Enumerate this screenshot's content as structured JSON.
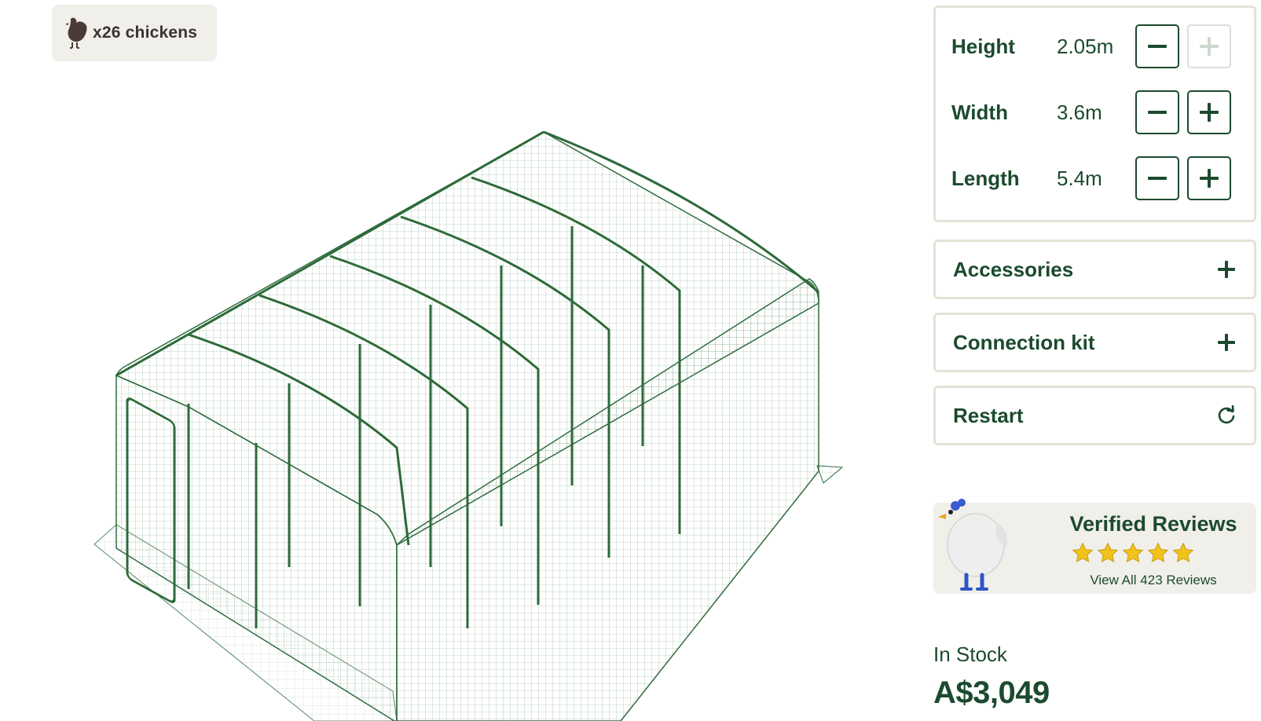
{
  "badge": {
    "icon": "chicken-icon",
    "label": "x26 chickens"
  },
  "dimensions": [
    {
      "label": "Height",
      "value": "2.05m",
      "decrease_enabled": true,
      "increase_enabled": false
    },
    {
      "label": "Width",
      "value": "3.6m",
      "decrease_enabled": true,
      "increase_enabled": true
    },
    {
      "label": "Length",
      "value": "5.4m",
      "decrease_enabled": true,
      "increase_enabled": true
    }
  ],
  "options": {
    "accessories": {
      "label": "Accessories",
      "icon": "plus-icon"
    },
    "connection_kit": {
      "label": "Connection kit",
      "icon": "plus-icon"
    },
    "restart": {
      "label": "Restart",
      "icon": "refresh-icon"
    }
  },
  "reviews": {
    "title": "Verified Reviews",
    "rating": 5,
    "link": "View All 423 Reviews",
    "mascot": "chicken-mascot-icon"
  },
  "stock_status": "In Stock",
  "price": "A$3,049",
  "colors": {
    "brand_green": "#1c4a2e",
    "panel_border": "#e2e3d6",
    "chip_bg": "#f1efea",
    "star_gold": "#f2c21c",
    "mesh_green": "#2f6b3e"
  }
}
